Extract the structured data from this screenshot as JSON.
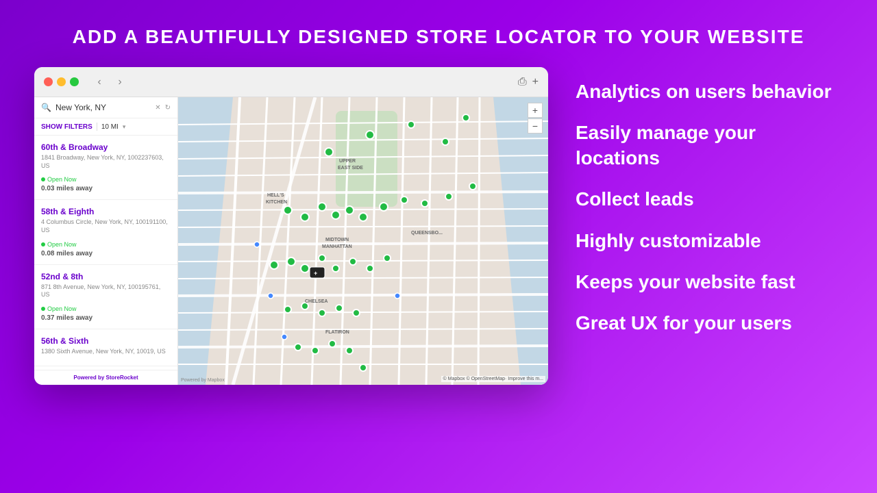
{
  "page": {
    "title": "ADD A BEAUTIFULLY DESIGNED STORE LOCATOR TO YOUR WEBSITE",
    "background_gradient": "linear-gradient(135deg, #7b00cc, #cc44ff)"
  },
  "browser": {
    "dots": [
      "#ff5f56",
      "#ffbd2e",
      "#27c93f"
    ],
    "nav_back": "‹",
    "nav_forward": "›",
    "action_share": "⎙",
    "action_add": "+"
  },
  "locator": {
    "search_value": "New York, NY",
    "search_placeholder": "New York, NY",
    "filter_label": "SHOW FILTERS",
    "distance_label": "10 MI",
    "locations": [
      {
        "name": "60th & Broadway",
        "address": "1841 Broadway, New York, NY, 1002237603, US",
        "open": true,
        "open_label": "Open Now",
        "distance": "0.03 miles away"
      },
      {
        "name": "58th & Eighth",
        "address": "4 Columbus Circle, New York, NY, 100191100, US",
        "open": true,
        "open_label": "Open Now",
        "distance": "0.08 miles away"
      },
      {
        "name": "52nd & 8th",
        "address": "871 8th Avenue, New York, NY, 100195761, US",
        "open": true,
        "open_label": "Open Now",
        "distance": "0.37 miles away"
      },
      {
        "name": "56th & Sixth",
        "address": "1380 Sixth Avenue, New York, NY, 10019, US",
        "open": false,
        "open_label": "",
        "distance": ""
      }
    ],
    "powered_by_prefix": "Powered by ",
    "powered_by_brand": "StoreRocket"
  },
  "features": [
    {
      "id": "analytics",
      "text": "Analytics on users behavior"
    },
    {
      "id": "manage-locations",
      "text": "Easily manage your locations"
    },
    {
      "id": "collect-leads",
      "text": "Collect leads"
    },
    {
      "id": "customizable",
      "text": "Highly customizable"
    },
    {
      "id": "fast",
      "text": "Keeps your website fast"
    },
    {
      "id": "ux",
      "text": "Great UX for your users"
    }
  ],
  "map": {
    "attribution": "© Mapbox © OpenStreetMap· Improve this m...",
    "logo": "🗺",
    "zoom_in": "+",
    "zoom_out": "−"
  }
}
